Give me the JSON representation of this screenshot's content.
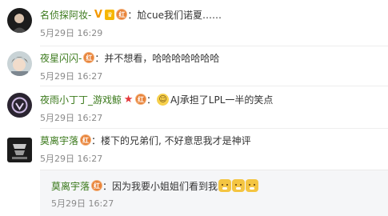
{
  "comments": [
    {
      "username": "名侦探阿妆-",
      "text": "尬cue我们诺夏……",
      "time": "5月29日 16:29",
      "avatar_icon": "dark-portrait-avatar"
    },
    {
      "username": "夜星闪闪-",
      "text": "并不想看，哈哈哈哈哈哈哈",
      "time": "5月29日 16:27",
      "avatar_icon": "anime-boy-avatar"
    },
    {
      "username": "夜雨小丁丁_游戏鲸",
      "text": "AJ承担了LPL一半的笑点",
      "time": "5月29日 16:27",
      "avatar_icon": "dark-logo-avatar"
    },
    {
      "username": "莫离宇落",
      "text": "楼下的兄弟们, 不好意思我才是神评",
      "time": "5月29日 16:27",
      "avatar_icon": "rng-logo-avatar"
    }
  ],
  "reply": {
    "username": "莫离宇落",
    "text": "因为我要小姐姐们看到我",
    "time": "5月29日 16:27"
  },
  "badges": {
    "hong": "红"
  },
  "colors": {
    "username": "#3c7a1d",
    "time": "#8a8a8a",
    "reply_bg": "#f5f6f8"
  }
}
